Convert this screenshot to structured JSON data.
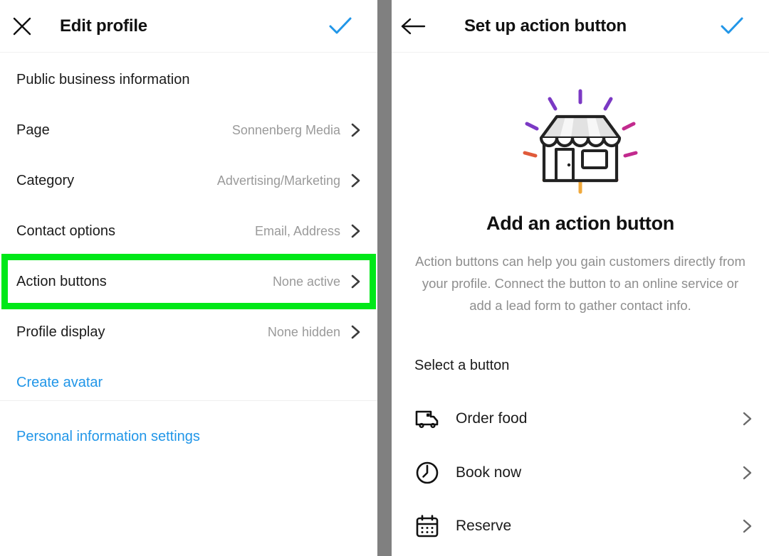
{
  "colors": {
    "accent_blue": "#2196e8",
    "highlight_green": "#00e818",
    "divider_gray": "#808080",
    "value_gray": "#9a9a9a",
    "text_dark": "#1b1b1b"
  },
  "left_panel": {
    "header": {
      "close_icon": "close-icon",
      "title": "Edit profile",
      "confirm_icon": "check-icon"
    },
    "section_title": "Public business information",
    "rows": [
      {
        "label": "Page",
        "value": "Sonnenberg Media",
        "chevron": "chevron-right-icon"
      },
      {
        "label": "Category",
        "value": "Advertising/Marketing",
        "chevron": "chevron-right-icon"
      },
      {
        "label": "Contact options",
        "value": "Email, Address",
        "chevron": "chevron-right-icon"
      },
      {
        "label": "Action buttons",
        "value": "None active",
        "chevron": "chevron-right-icon",
        "highlighted": true
      },
      {
        "label": "Profile display",
        "value": "None hidden",
        "chevron": "chevron-right-icon"
      }
    ],
    "links": [
      {
        "label": "Create avatar"
      },
      {
        "label": "Personal information settings"
      }
    ]
  },
  "right_panel": {
    "header": {
      "back_icon": "arrow-left-icon",
      "title": "Set up action button",
      "confirm_icon": "check-icon"
    },
    "illustration": "storefront-icon",
    "hero_title": "Add an action button",
    "hero_description": "Action buttons can help you gain customers directly from your profile. Connect the button to an online service or add a lead form to gather contact info.",
    "select_title": "Select a button",
    "options": [
      {
        "label": "Order food",
        "icon": "delivery-truck-icon",
        "chevron": "chevron-right-icon"
      },
      {
        "label": "Book now",
        "icon": "clock-icon",
        "chevron": "chevron-right-icon"
      },
      {
        "label": "Reserve",
        "icon": "calendar-icon",
        "chevron": "chevron-right-icon"
      }
    ]
  }
}
